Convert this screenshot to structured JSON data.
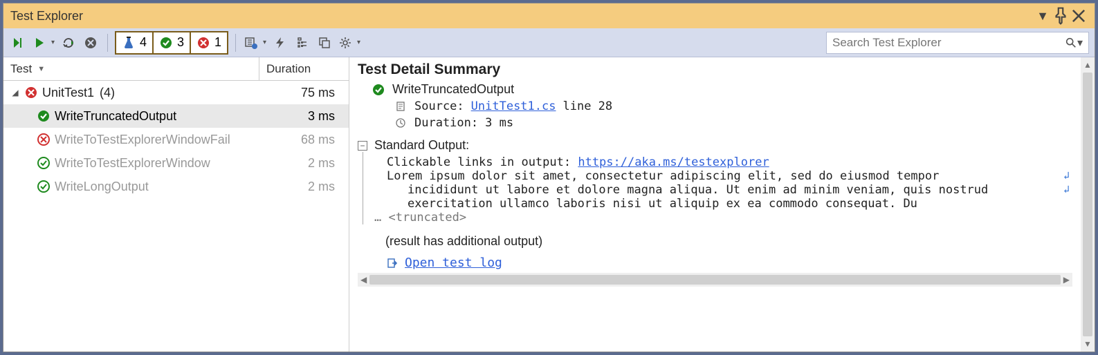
{
  "window": {
    "title": "Test Explorer"
  },
  "toolbar": {
    "counts": {
      "total": "4",
      "passed": "3",
      "failed": "1"
    },
    "search_placeholder": "Search Test Explorer"
  },
  "tree": {
    "columns": {
      "test": "Test",
      "duration": "Duration"
    },
    "group": {
      "name": "UnitTest1",
      "count": "(4)",
      "duration": "75 ms",
      "status": "failed"
    },
    "items": [
      {
        "name": "WriteTruncatedOutput",
        "duration": "3 ms",
        "status": "pass-solid",
        "selected": true
      },
      {
        "name": "WriteToTestExplorerWindowFail",
        "duration": "68 ms",
        "status": "fail-outline",
        "dim": true
      },
      {
        "name": "WriteToTestExplorerWindow",
        "duration": "2 ms",
        "status": "pass-outline",
        "dim": true
      },
      {
        "name": "WriteLongOutput",
        "duration": "2 ms",
        "status": "pass-outline",
        "dim": true
      }
    ]
  },
  "detail": {
    "heading": "Test Detail Summary",
    "test_name": "WriteTruncatedOutput",
    "source_label": "Source:",
    "source_file": "UnitTest1.cs",
    "source_line": "line 28",
    "duration_label": "Duration:",
    "duration_value": "3 ms",
    "output_label": "Standard Output:",
    "output_line1_prefix": "Clickable links in output: ",
    "output_link": "https://aka.ms/testexplorer",
    "output_line2": "Lorem ipsum dolor sit amet, consectetur adipiscing elit, sed do eiusmod tempor",
    "output_line3": "incididunt ut labore et dolore magna aliqua. Ut enim ad minim veniam, quis nostrud",
    "output_line4": "exercitation ullamco laboris nisi ut aliquip ex ea commodo consequat. Du",
    "truncated_marker": "… <truncated>",
    "additional": "(result has additional output)",
    "open_log": "Open test log"
  }
}
